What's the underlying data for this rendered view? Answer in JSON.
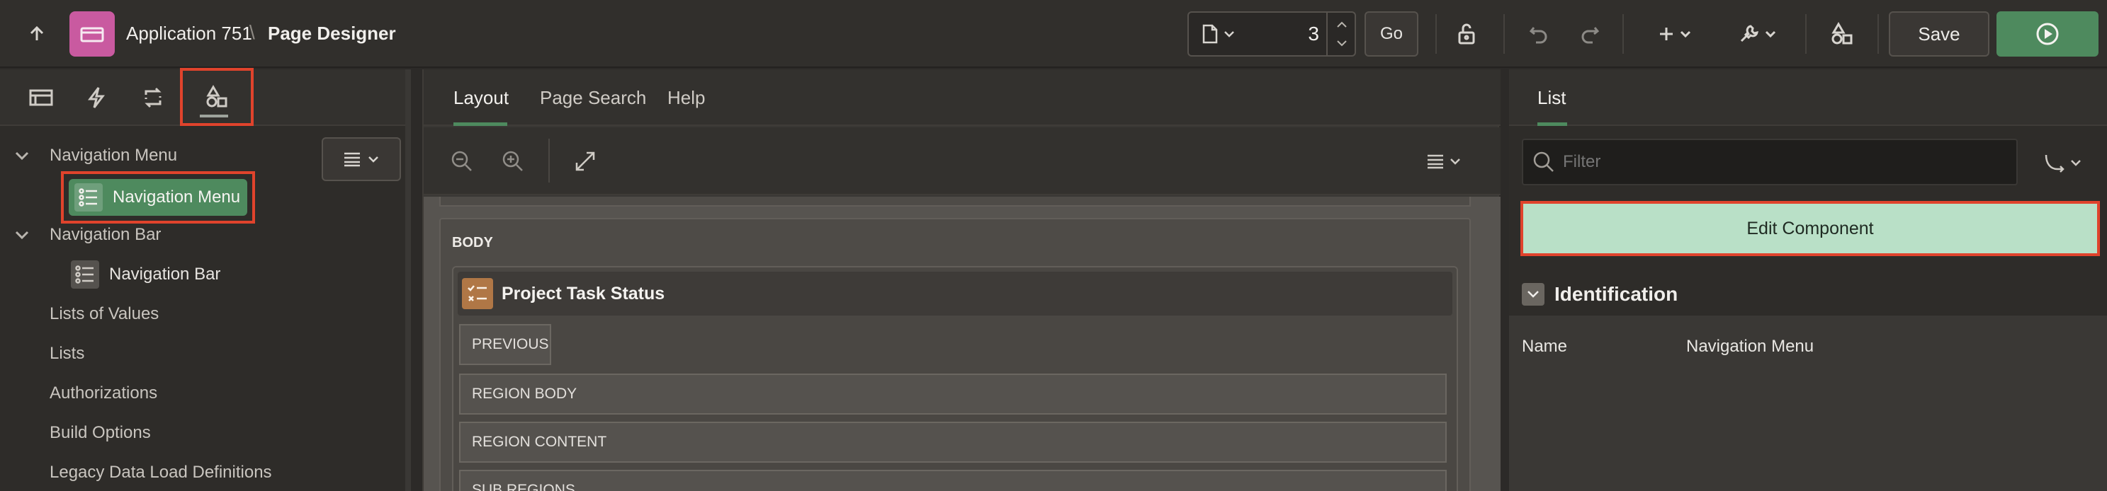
{
  "header": {
    "app_name": "Application 751",
    "separator": "\\",
    "page_title": "Page Designer",
    "page_number": "3",
    "go_label": "Go",
    "save_label": "Save"
  },
  "left_panel": {
    "tabs": [
      "rendering-tab",
      "dynamic-actions-tab",
      "processing-tab",
      "shared-components-tab"
    ],
    "tree": [
      {
        "label": "Navigation Menu",
        "level": 0,
        "expandable": true
      },
      {
        "label": "Navigation Menu",
        "level": 1,
        "selected": true
      },
      {
        "label": "Navigation Bar",
        "level": 0,
        "expandable": true
      },
      {
        "label": "Navigation Bar",
        "level": 1
      },
      {
        "label": "Lists of Values",
        "level": 0
      },
      {
        "label": "Lists",
        "level": 0
      },
      {
        "label": "Authorizations",
        "level": 0
      },
      {
        "label": "Build Options",
        "level": 0
      },
      {
        "label": "Legacy Data Load Definitions",
        "level": 0
      }
    ]
  },
  "middle_panel": {
    "tabs": [
      "Layout",
      "Page Search",
      "Help"
    ],
    "active_tab": "Layout",
    "canvas": {
      "body_label": "BODY",
      "region_title": "Project Task Status",
      "slots": [
        "PREVIOUS",
        "REGION BODY",
        "REGION CONTENT",
        "SUB REGIONS"
      ]
    }
  },
  "right_panel": {
    "tabs": [
      "List"
    ],
    "filter_placeholder": "Filter",
    "edit_component_label": "Edit Component",
    "section_title": "Identification",
    "properties": [
      {
        "label": "Name",
        "value": "Navigation Menu"
      }
    ]
  },
  "colors": {
    "accent_green": "#4e8a5e",
    "highlight_red": "#e0432c",
    "app_icon": "#c95aa0",
    "edit_component_bg": "#b9e0c7"
  }
}
